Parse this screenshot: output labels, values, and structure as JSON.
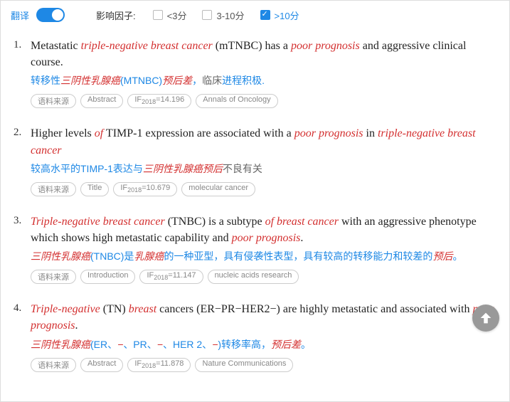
{
  "topbar": {
    "translate_label": "翻译",
    "if_label": "影响因子:",
    "filters": [
      {
        "label": "<3分",
        "checked": false
      },
      {
        "label": "3-10分",
        "checked": false
      },
      {
        "label": ">10分",
        "checked": true
      }
    ]
  },
  "results": [
    {
      "num": "1.",
      "eng_segments": [
        {
          "t": "Metastatic ",
          "hl": false
        },
        {
          "t": "triple-negative breast cancer",
          "hl": true
        },
        {
          "t": " (mTNBC) has a ",
          "hl": false
        },
        {
          "t": "poor prognosis",
          "hl": true
        },
        {
          "t": " and aggressive clinical course.",
          "hl": false
        }
      ],
      "chn_segments": [
        {
          "t": "转移性",
          "cls": ""
        },
        {
          "t": "三阴性乳腺癌",
          "cls": "hl"
        },
        {
          "t": "(MTNBC)",
          "cls": ""
        },
        {
          "t": "预后差",
          "cls": "hl"
        },
        {
          "t": "，",
          "cls": ""
        },
        {
          "t": "临床",
          "cls": "plain"
        },
        {
          "t": "进程积极.",
          "cls": ""
        }
      ],
      "tags": [
        "语料来源",
        "Abstract",
        "IF2018=14.196",
        "Annals of Oncology"
      ]
    },
    {
      "num": "2.",
      "eng_segments": [
        {
          "t": "Higher levels ",
          "hl": false
        },
        {
          "t": "of",
          "hl": true
        },
        {
          "t": " TIMP-1 expression are associated with a ",
          "hl": false
        },
        {
          "t": "poor prognosis",
          "hl": true
        },
        {
          "t": " in ",
          "hl": false
        },
        {
          "t": "triple-negative breast cancer",
          "hl": true
        }
      ],
      "chn_segments": [
        {
          "t": "较高水平的TIMP-1表达与",
          "cls": ""
        },
        {
          "t": "三阴性乳腺癌预后",
          "cls": "hl"
        },
        {
          "t": "不良有关",
          "cls": "plain"
        }
      ],
      "tags": [
        "语料来源",
        "Title",
        "IF2018=10.679",
        "molecular cancer"
      ]
    },
    {
      "num": "3.",
      "eng_segments": [
        {
          "t": "Triple-negative breast cancer",
          "hl": true
        },
        {
          "t": " (TNBC) is a subtype ",
          "hl": false
        },
        {
          "t": "of breast cancer",
          "hl": true
        },
        {
          "t": " with an aggressive phenotype which shows high metastatic capability and ",
          "hl": false
        },
        {
          "t": "poor prognosis",
          "hl": true
        },
        {
          "t": ".",
          "hl": false
        }
      ],
      "chn_segments": [
        {
          "t": "三阴性乳腺癌",
          "cls": "hl"
        },
        {
          "t": "(TNBC)是",
          "cls": ""
        },
        {
          "t": "乳腺癌",
          "cls": "hl"
        },
        {
          "t": "的一种亚型，具有侵袭性表型，具有较高的转移能力和较差的",
          "cls": ""
        },
        {
          "t": "预后",
          "cls": "hl"
        },
        {
          "t": "。",
          "cls": ""
        }
      ],
      "tags": [
        "语料来源",
        "Introduction",
        "IF2018=11.147",
        "nucleic acids research"
      ]
    },
    {
      "num": "4.",
      "eng_segments": [
        {
          "t": "Triple-negative",
          "hl": true
        },
        {
          "t": " (TN) ",
          "hl": false
        },
        {
          "t": "breast",
          "hl": true
        },
        {
          "t": " cancers (ER−PR−HER2−) are highly metastatic and associated with ",
          "hl": false
        },
        {
          "t": "poor prognosis",
          "hl": true
        },
        {
          "t": ".",
          "hl": false
        }
      ],
      "chn_segments": [
        {
          "t": "三阴性乳腺癌",
          "cls": "hl"
        },
        {
          "t": "(ER、",
          "cls": ""
        },
        {
          "t": "−",
          "cls": "hl"
        },
        {
          "t": "、PR、",
          "cls": ""
        },
        {
          "t": "−",
          "cls": "hl"
        },
        {
          "t": "、HER 2、",
          "cls": ""
        },
        {
          "t": "−",
          "cls": "hl"
        },
        {
          "t": ")转移率高，",
          "cls": ""
        },
        {
          "t": "预后差",
          "cls": "hl"
        },
        {
          "t": "。",
          "cls": ""
        }
      ],
      "tags": [
        "语料来源",
        "Abstract",
        "IF2018=11.878",
        "Nature Communications"
      ]
    }
  ]
}
